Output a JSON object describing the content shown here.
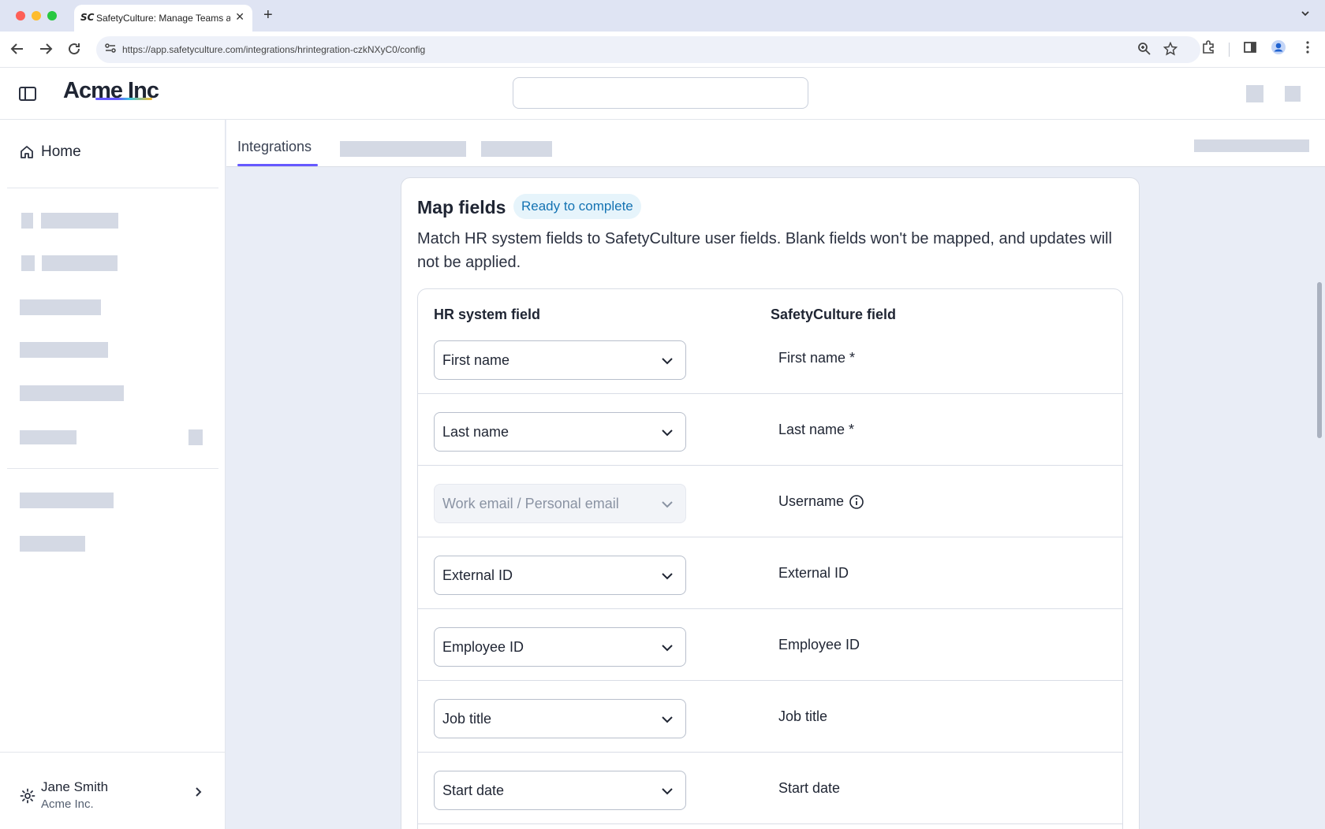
{
  "browser": {
    "tab_favicon": "SC",
    "tab_title": "SafetyCulture: Manage Teams and...",
    "tab_close": "✕",
    "new_tab": "+",
    "url": "https://app.safetyculture.com/integrations/hrintegration-czkNXyC0/config",
    "colors": {
      "close": "#fe5f57",
      "minimize": "#febc2e",
      "maximize": "#28c840"
    }
  },
  "header": {
    "logo": "Acme Inc"
  },
  "sidebar": {
    "home_label": "Home",
    "user": {
      "name": "Jane Smith",
      "org": "Acme Inc."
    }
  },
  "tabs": {
    "active": "Integrations"
  },
  "card": {
    "title": "Map fields",
    "status": "Ready to complete",
    "description": "Match HR system fields to SafetyCulture user fields. Blank fields won't be mapped, and updates will not be applied.",
    "columns": {
      "hr": "HR system field",
      "sc": "SafetyCulture field"
    },
    "rows": [
      {
        "hr_value": "First name",
        "sc_field": "First name *",
        "disabled": false
      },
      {
        "hr_value": "Last name",
        "sc_field": "Last name *",
        "disabled": false
      },
      {
        "hr_value": "Work email / Personal email",
        "sc_field": "Username",
        "disabled": true,
        "info_icon": true
      },
      {
        "hr_value": "External ID",
        "sc_field": "External ID",
        "disabled": false
      },
      {
        "hr_value": "Employee ID",
        "sc_field": "Employee ID",
        "disabled": false
      },
      {
        "hr_value": "Job title",
        "sc_field": "Job title",
        "disabled": false
      },
      {
        "hr_value": "Start date",
        "sc_field": "Start date",
        "disabled": false
      }
    ]
  },
  "accent_color": "#6559ff",
  "badge_color": "#1473b3"
}
